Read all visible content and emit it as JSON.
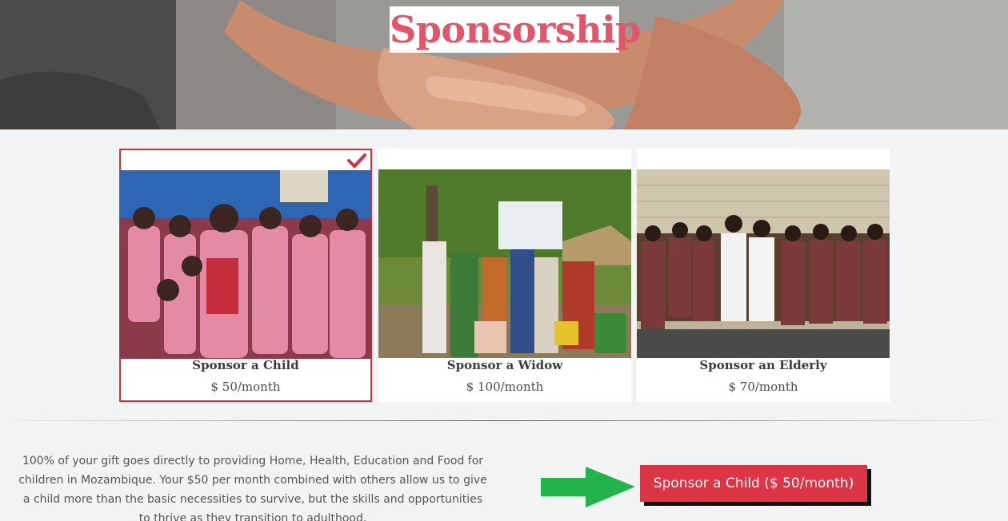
{
  "hero": {
    "title": "Sponsorship",
    "background_image": "hands-holding-hands"
  },
  "cards": [
    {
      "name": "Sponsor a Child",
      "price": "$ 50/month",
      "selected": true,
      "photo": "children-in-pink-uniforms"
    },
    {
      "name": "Sponsor a Widow",
      "price": "$ 100/month",
      "selected": false,
      "photo": "widows-under-tree"
    },
    {
      "name": "Sponsor an Elderly",
      "price": "$ 70/month",
      "selected": false,
      "photo": "elderly-group-indoors"
    }
  ],
  "description": "100% of your gift goes directly to providing Home, Health, Education and Food for children in Mozambique. Your $50 per month combined with others allow us to give a child more than the basic necessities to survive, but the skills and opportunities to thrive as they transition to adulthood.",
  "cta": {
    "label": "Sponsor a Child ($ 50/month)"
  },
  "icons": {
    "selected_check": "check-icon",
    "pointer": "green-arrow-icon"
  },
  "colors": {
    "accent": "#dc3545",
    "title": "#e0566a",
    "arrow": "#22b34a",
    "page_bg": "#f2f3f5"
  }
}
